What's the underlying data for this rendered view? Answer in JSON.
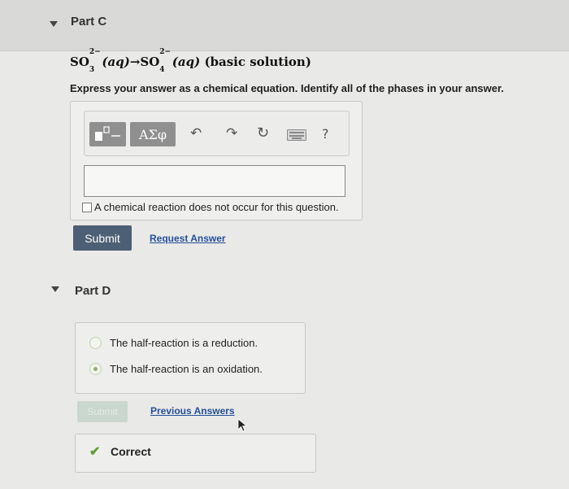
{
  "part_c": {
    "title": "Part C",
    "equation": {
      "reactant": "SO",
      "reactant_sub": "3",
      "reactant_sup": "2−",
      "reactant_phase": "(aq)",
      "arrow": "→",
      "product": "SO",
      "product_sub": "4",
      "product_sup": "2−",
      "product_phase": "(aq)",
      "condition": "(basic solution)"
    },
    "instruction": "Express your answer as a chemical equation. Identify all of the phases in your answer.",
    "toolbar": {
      "greek_label": "ΑΣφ",
      "help_label": "?"
    },
    "answer_value": "",
    "no_reaction_label": "A chemical reaction does not occur for this question.",
    "submit_label": "Submit",
    "request_answer_label": "Request Answer"
  },
  "part_d": {
    "title": "Part D",
    "options": [
      {
        "label": "The half-reaction is a reduction.",
        "selected": false
      },
      {
        "label": "The half-reaction is an oxidation.",
        "selected": true
      }
    ],
    "submit_label": "Submit",
    "previous_answers_label": "Previous Answers",
    "feedback": "Correct"
  },
  "colors": {
    "submit_bg": "#4d5f74",
    "link": "#24509a",
    "correct_check": "#5e9e34"
  }
}
